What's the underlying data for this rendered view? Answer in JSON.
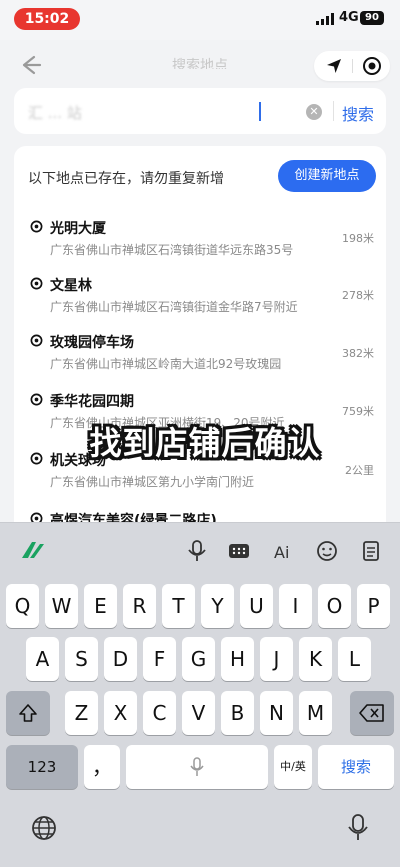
{
  "status_bar": {
    "time": "15:02",
    "network": "4G",
    "battery": "90"
  },
  "nav": {
    "title": "搜索地点"
  },
  "search": {
    "query": "汇 ... 站",
    "button_label": "搜索"
  },
  "notice": {
    "text": "以下地点已存在，请勿重复新增",
    "create_label": "创建新地点"
  },
  "results": [
    {
      "name": "光明大厦",
      "address": "广东省佛山市禅城区石湾镇街道华远东路35号",
      "distance": "198米"
    },
    {
      "name": "文星林",
      "address": "广东省佛山市禅城区石湾镇街道金华路7号附近",
      "distance": "278米"
    },
    {
      "name": "玫瑰园停车场",
      "address": "广东省佛山市禅城区岭南大道北92号玫瑰园",
      "distance": "382米"
    },
    {
      "name": "季华花园四期",
      "address": "广东省佛山市禅城区亚洲横街19、20号附近",
      "distance": "759米"
    },
    {
      "name": "机关球场",
      "address": "广东省佛山市禅城区第九小学南门附近",
      "distance": "2公里"
    },
    {
      "name": "高煜汽车美容(绿景二路店)",
      "address": "",
      "distance": ""
    }
  ],
  "caption": "找到店铺后确认",
  "keyboard": {
    "row1": [
      "Q",
      "W",
      "E",
      "R",
      "T",
      "Y",
      "U",
      "I",
      "O",
      "P"
    ],
    "row2": [
      "A",
      "S",
      "D",
      "F",
      "G",
      "H",
      "J",
      "K",
      "L"
    ],
    "row3": [
      "Z",
      "X",
      "C",
      "V",
      "B",
      "N",
      "M"
    ],
    "num_label": "123",
    "punct_label": "，",
    "lang_label": "中/英",
    "search_label": "搜索"
  },
  "colors": {
    "accent": "#2c6cf0",
    "status_red": "#e8362f"
  }
}
